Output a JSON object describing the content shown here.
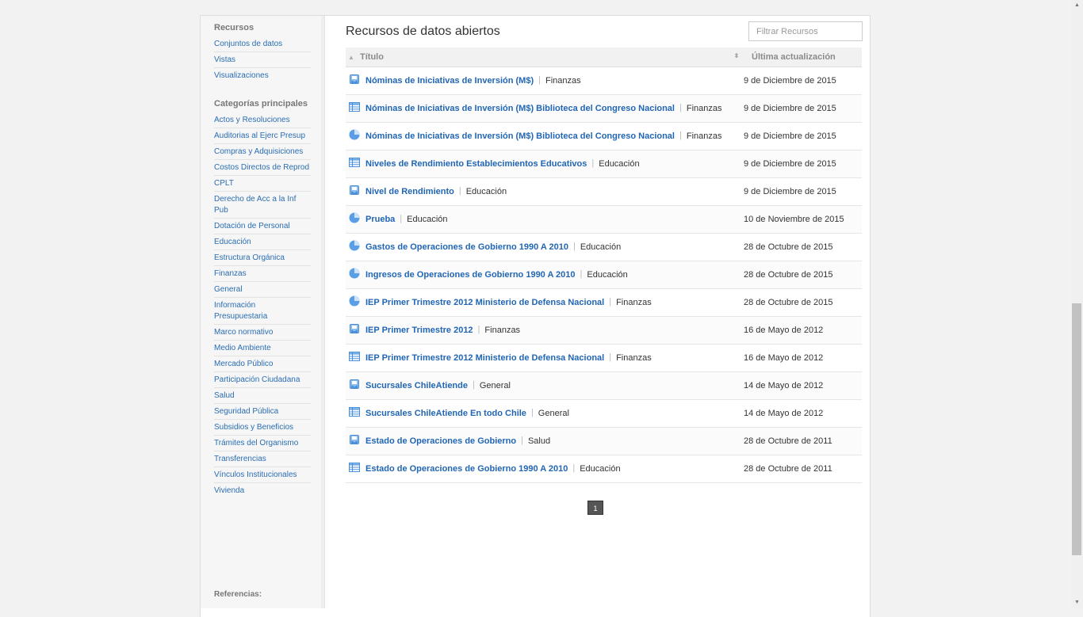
{
  "sidebar": {
    "resources_heading": "Recursos",
    "resources": [
      "Conjuntos de datos",
      "Vistas",
      "Visualizaciones"
    ],
    "categories_heading": "Categorías principales",
    "categories": [
      "Actos y Resoluciones",
      "Auditorias al Ejerc Presup",
      "Compras y Adquisiciones",
      "Costos Directos de Reprod",
      "CPLT",
      "Derecho de Acc a la Inf Pub",
      "Dotación de Personal",
      "Educación",
      "Estructura Orgánica",
      "Finanzas",
      "General",
      "Información Presupuestaria",
      "Marco normativo",
      "Medio Ambiente",
      "Mercado Público",
      "Participación Ciudadana",
      "Salud",
      "Seguridad Pública",
      "Subsidios y Beneficios",
      "Trámites del Organismo",
      "Transferencias",
      "Vínculos Institucionales",
      "Vivienda"
    ],
    "references_heading": "Referencias:"
  },
  "main": {
    "title": "Recursos de datos abiertos",
    "filter_placeholder": "Filtrar Recursos",
    "columns": {
      "title": "Título",
      "updated": "Última actualización"
    },
    "rows": [
      {
        "icon": "dataset-icon",
        "title": "Nóminas de Iniciativas de Inversión (M$)",
        "category": "Finanzas",
        "date": "9 de Diciembre de 2015"
      },
      {
        "icon": "table-icon",
        "title": "Nóminas de Iniciativas de Inversión (M$) Biblioteca del Congreso Nacional",
        "category": "Finanzas",
        "date": "9 de Diciembre de 2015"
      },
      {
        "icon": "chart-icon",
        "title": "Nóminas de Iniciativas de Inversión (M$) Biblioteca del Congreso Nacional",
        "category": "Finanzas",
        "date": "9 de Diciembre de 2015"
      },
      {
        "icon": "table-icon",
        "title": "Niveles de Rendimiento Establecimientos Educativos",
        "category": "Educación",
        "date": "9 de Diciembre de 2015"
      },
      {
        "icon": "dataset-icon",
        "title": "Nivel de Rendimiento",
        "category": "Educación",
        "date": "9 de Diciembre de 2015"
      },
      {
        "icon": "chart-icon",
        "title": "Prueba",
        "category": "Educación",
        "date": "10 de Noviembre de 2015"
      },
      {
        "icon": "chart-icon",
        "title": "Gastos de Operaciones de Gobierno 1990 A 2010",
        "category": "Educación",
        "date": "28 de Octubre de 2015"
      },
      {
        "icon": "chart-icon",
        "title": "Ingresos de Operaciones de Gobierno 1990 A 2010",
        "category": "Educación",
        "date": "28 de Octubre de 2015"
      },
      {
        "icon": "chart-icon",
        "title": "IEP Primer Trimestre 2012 Ministerio de Defensa Nacional",
        "category": "Finanzas",
        "date": "28 de Octubre de 2015"
      },
      {
        "icon": "dataset-icon",
        "title": "IEP Primer Trimestre 2012",
        "category": "Finanzas",
        "date": "16 de Mayo de 2012"
      },
      {
        "icon": "table-icon",
        "title": "IEP Primer Trimestre 2012 Ministerio de Defensa Nacional",
        "category": "Finanzas",
        "date": "16 de Mayo de 2012"
      },
      {
        "icon": "dataset-icon",
        "title": "Sucursales ChileAtiende",
        "category": "General",
        "date": "14 de Mayo de 2012"
      },
      {
        "icon": "table-icon",
        "title": "Sucursales ChileAtiende En todo Chile",
        "category": "General",
        "date": "14 de Mayo de 2012"
      },
      {
        "icon": "dataset-icon",
        "title": "Estado de Operaciones de Gobierno",
        "category": "Salud",
        "date": "28 de Octubre de 2011"
      },
      {
        "icon": "table-icon",
        "title": "Estado de Operaciones de Gobierno 1990 A 2010",
        "category": "Educación",
        "date": "28 de Octubre de 2011"
      }
    ],
    "pagination": {
      "current_page": "1"
    }
  },
  "colors": {
    "link": "#2166b4",
    "icon": "#5a9ee6",
    "header_bg": "#f1f1f1",
    "pager_bg": "#555555"
  }
}
